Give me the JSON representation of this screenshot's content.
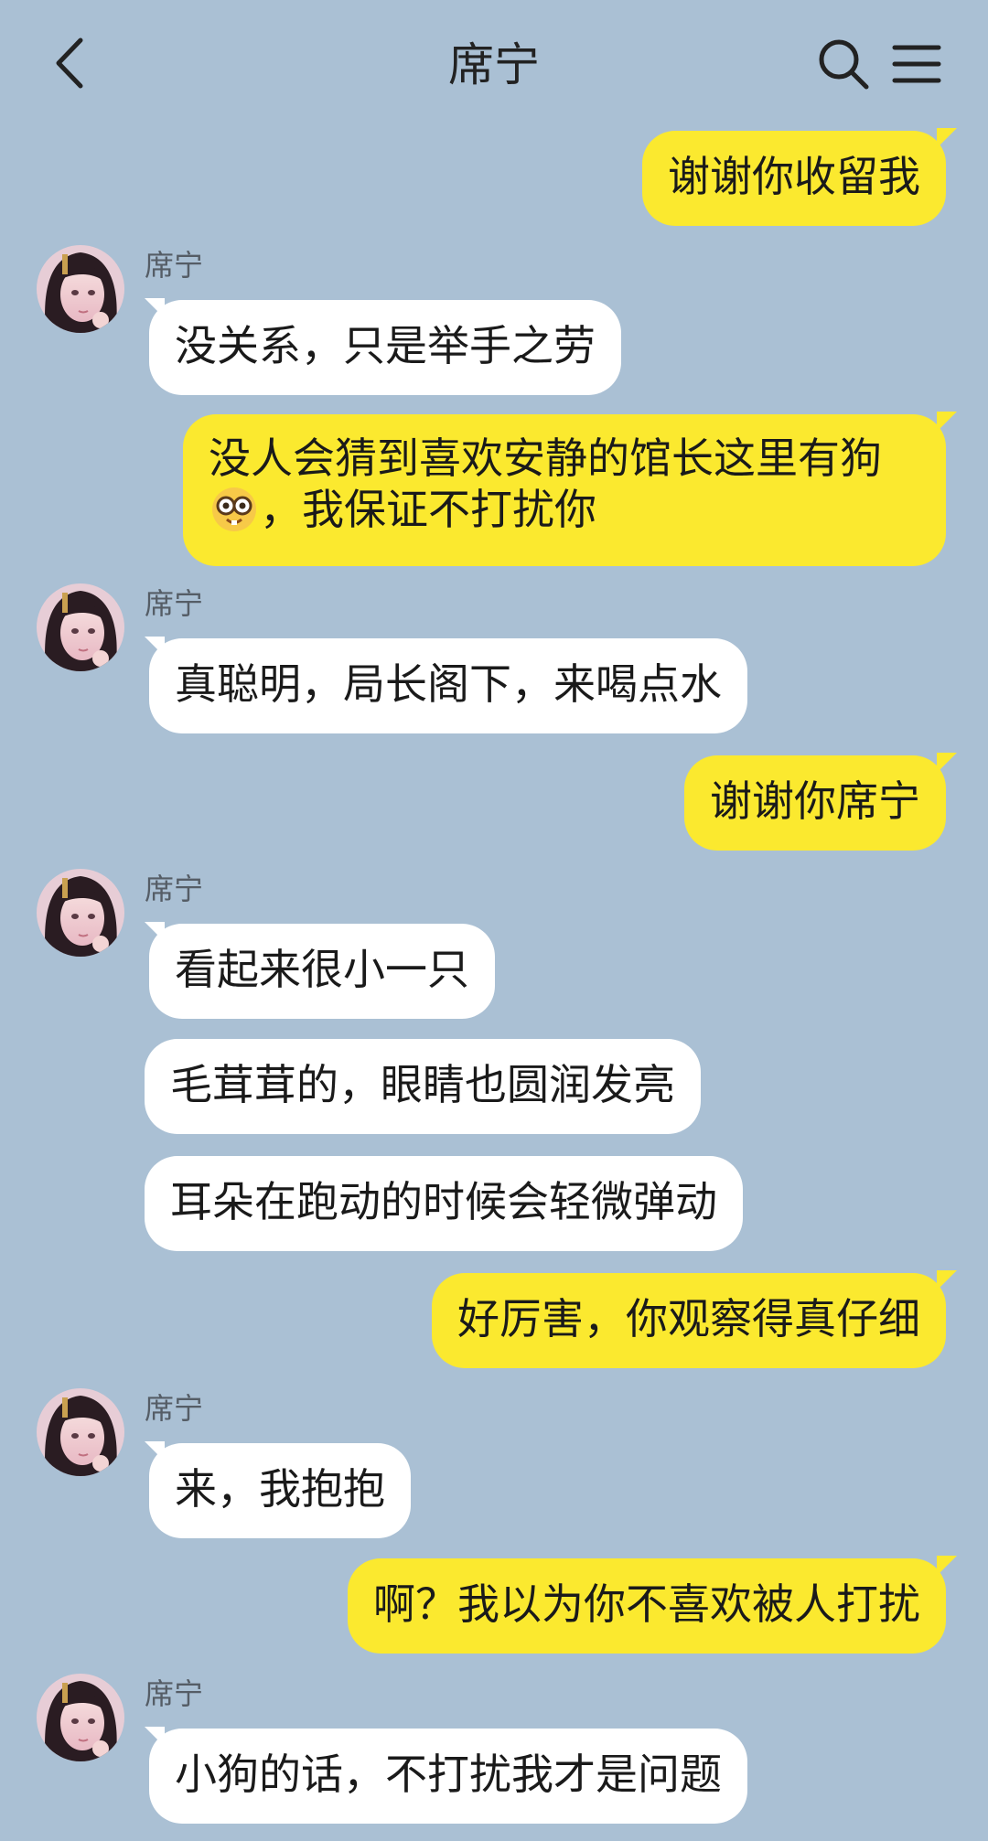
{
  "header": {
    "title": "席宁"
  },
  "contact_name": "席宁",
  "messages": [
    {
      "side": "me",
      "text": "谢谢你收留我"
    },
    {
      "side": "other",
      "text": "没关系，只是举手之劳"
    },
    {
      "side": "me",
      "text": "没人会猜到喜欢安静的馆长这里有狗",
      "emoji": "nerd-face",
      "text_after": "，我保证不打扰你"
    },
    {
      "side": "other",
      "text": "真聪明，局长阁下，来喝点水"
    },
    {
      "side": "me",
      "text": "谢谢你席宁"
    },
    {
      "side": "other",
      "text": "看起来很小一只"
    },
    {
      "side": "other",
      "text": "毛茸茸的，眼睛也圆润发亮"
    },
    {
      "side": "other",
      "text": "耳朵在跑动的时候会轻微弹动"
    },
    {
      "side": "me",
      "text": "好厉害，你观察得真仔细"
    },
    {
      "side": "other",
      "text": "来，我抱抱"
    },
    {
      "side": "me",
      "text": "啊？我以为你不喜欢被人打扰"
    },
    {
      "side": "other",
      "text": "小狗的话，不打扰我才是问题"
    }
  ],
  "colors": {
    "background": "#aac0d4",
    "my_bubble": "#fbe92f",
    "their_bubble": "#ffffff"
  },
  "icons": [
    "back-icon",
    "search-icon",
    "menu-icon"
  ]
}
